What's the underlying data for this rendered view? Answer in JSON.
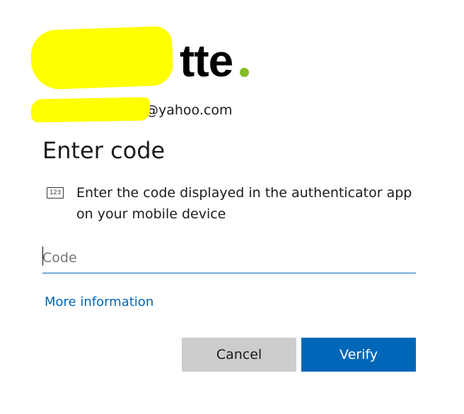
{
  "logo": {
    "visible_text": "tte",
    "dot_color": "#86bc25",
    "redacted": true
  },
  "account": {
    "email_suffix": "@yahoo.com",
    "redacted": true
  },
  "title": "Enter code",
  "instruction": {
    "icon": "code-icon",
    "icon_text": "123",
    "text": "Enter the code displayed in the authenticator app on your mobile device"
  },
  "code_input": {
    "placeholder": "Code",
    "value": ""
  },
  "more_info_link": "More information",
  "buttons": {
    "cancel_label": "Cancel",
    "verify_label": "Verify"
  },
  "colors": {
    "accent": "#0067b8",
    "secondary_button": "#cccccc",
    "highlighter": "#ffff00"
  }
}
